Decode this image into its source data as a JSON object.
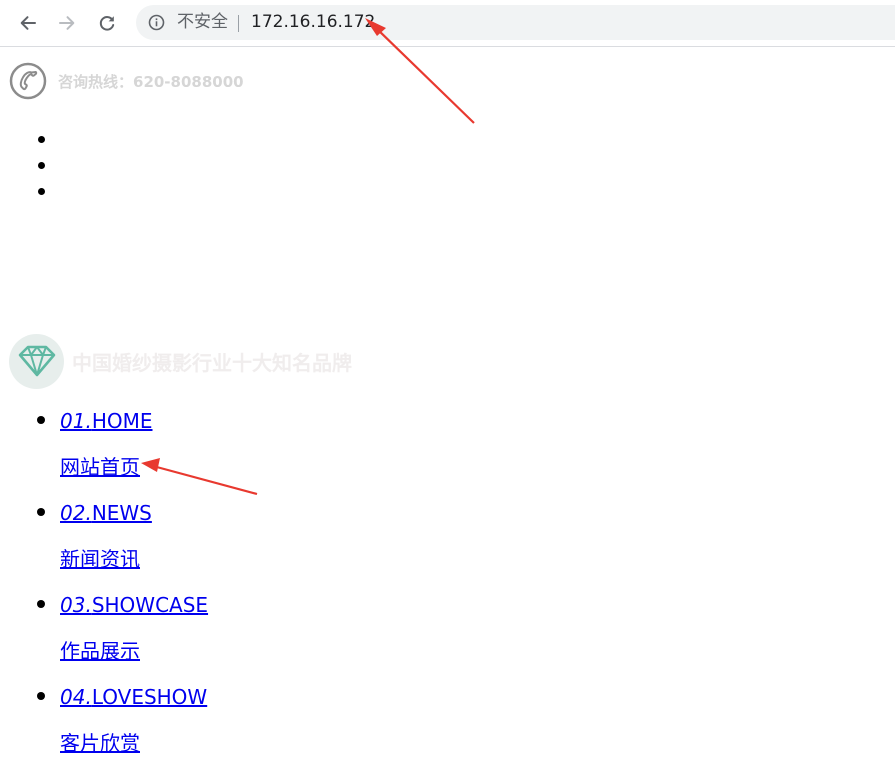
{
  "browser": {
    "back_icon": "arrow-left-icon",
    "forward_icon": "arrow-right-icon",
    "reload_icon": "reload-icon",
    "info_icon": "info-icon",
    "security_label": "不安全",
    "url": "172.16.16.172"
  },
  "header": {
    "phone_icon": "phone-icon",
    "hotline": "咨询热线：620-8088000"
  },
  "empty_list_count": 3,
  "brand": {
    "icon": "diamond-icon",
    "slogan": "中国婚纱摄影行业十大知名品牌"
  },
  "nav": {
    "items": [
      {
        "number": "01.",
        "en": "HOME",
        "cn": "网站首页"
      },
      {
        "number": "02.",
        "en": "NEWS",
        "cn": "新闻资讯"
      },
      {
        "number": "03.",
        "en": "SHOWCASE",
        "cn": "作品展示"
      },
      {
        "number": "04.",
        "en": "LOVESHOW",
        "cn": "客片欣赏"
      }
    ]
  },
  "colors": {
    "link": "#0000ee",
    "annotation_arrow": "#e8392f",
    "diamond": "#5fb8a2",
    "faded_text": "#d6d6d6"
  }
}
